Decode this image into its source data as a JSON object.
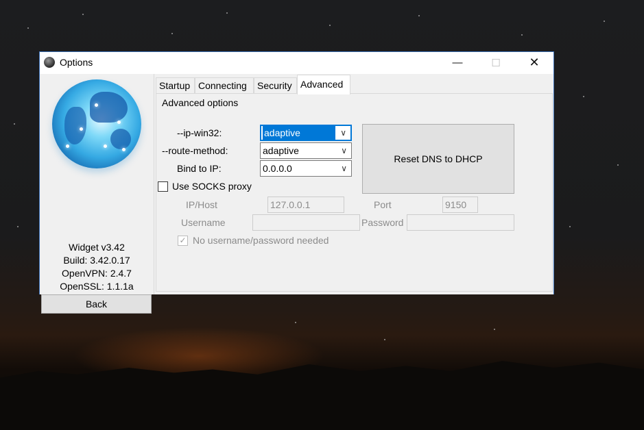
{
  "window": {
    "title": "Options",
    "minimize_glyph": "—",
    "maximize_glyph": "☐",
    "close_glyph": "✕"
  },
  "sidebar": {
    "widget_version": "Widget v3.42",
    "build": "Build: 3.42.0.17",
    "openvpn": "OpenVPN: 2.4.7",
    "openssl": "OpenSSL: 1.1.1a",
    "back_label": "Back"
  },
  "tabs": [
    {
      "label": "Startup",
      "active": false
    },
    {
      "label": "Connecting",
      "active": false
    },
    {
      "label": "Security",
      "active": false
    },
    {
      "label": "Advanced",
      "active": true
    }
  ],
  "advanced": {
    "heading": "Advanced options",
    "ip_win32_label": "--ip-win32:",
    "ip_win32_value": "adaptive",
    "route_method_label": "--route-method:",
    "route_method_value": "adaptive",
    "bind_ip_label": "Bind to IP:",
    "bind_ip_value": "0.0.0.0",
    "reset_dns_label": "Reset DNS to DHCP",
    "use_socks_label": "Use SOCKS proxy",
    "use_socks_checked": false,
    "ip_host_label": "IP/Host",
    "ip_host_value": "127.0.0.1",
    "port_label": "Port",
    "port_value": "9150",
    "username_label": "Username",
    "username_value": "",
    "password_label": "Password",
    "password_value": "",
    "no_auth_label": "No username/password needed",
    "no_auth_checked": true
  },
  "icons": {
    "app": "globe-app-icon",
    "dropdown": "chevron-down-icon",
    "check": "✓"
  },
  "colors": {
    "accent": "#0078d7",
    "window_border": "#3b6fb6"
  }
}
